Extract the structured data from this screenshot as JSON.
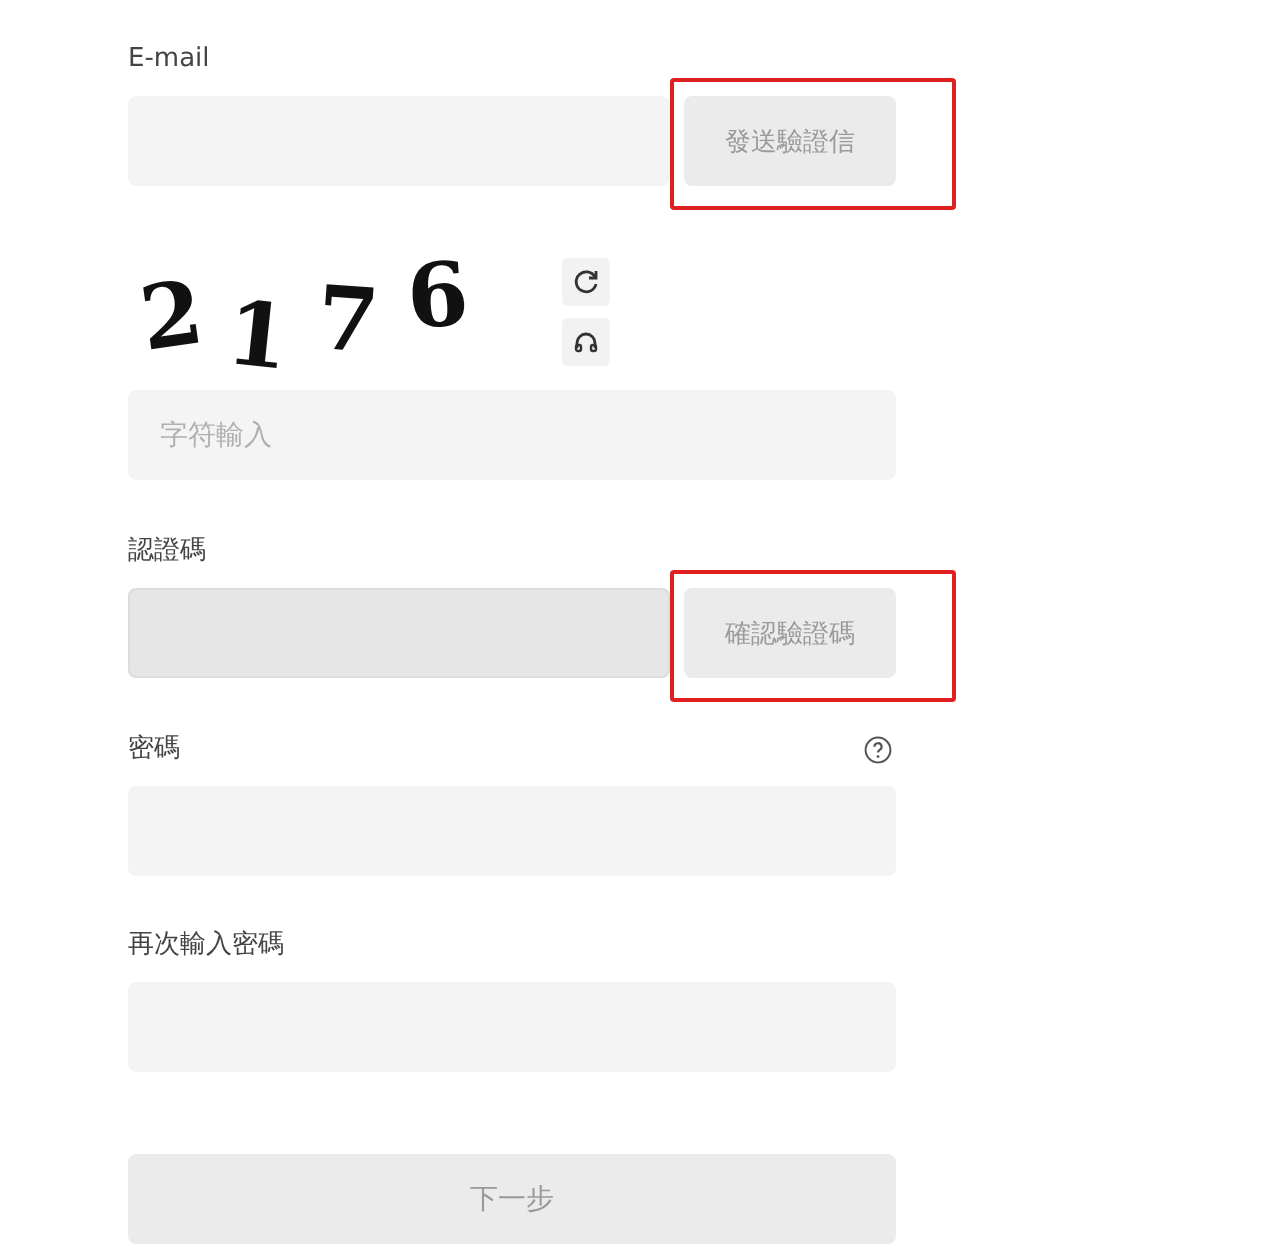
{
  "email": {
    "label": "E-mail",
    "button": {
      "label": "發送驗證信",
      "disabled": true,
      "highlighted": true
    }
  },
  "captcha": {
    "characters": [
      "2",
      "1",
      "7",
      "6"
    ],
    "placeholder": "字符輸入"
  },
  "verification": {
    "label": "認證碼",
    "disabled": true,
    "button": {
      "label": "確認驗證碼",
      "disabled": true,
      "highlighted": true
    }
  },
  "password": {
    "label": "密碼",
    "help": true
  },
  "confirm_password": {
    "label": "再次輸入密碼"
  },
  "next_button": {
    "label": "下一步",
    "disabled": true
  }
}
